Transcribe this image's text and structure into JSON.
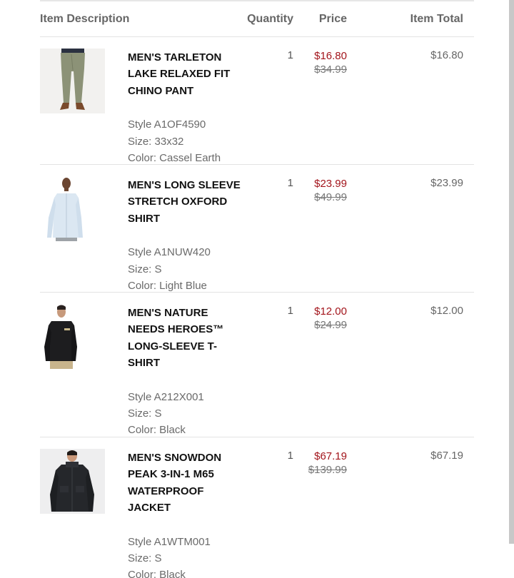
{
  "header": {
    "description": "Item Description",
    "quantity": "Quantity",
    "price": "Price",
    "total": "Item Total"
  },
  "items": [
    {
      "name": "MEN'S TARLETON LAKE RELAXED FIT CHINO PANT",
      "style": "Style A1OF4590",
      "size": "Size: 33x32",
      "color": "Color: Cassel Earth",
      "quantity": "1",
      "sale_price": "$16.80",
      "original_price": "$34.99",
      "total": "$16.80",
      "image": "chino-pant-photo"
    },
    {
      "name": "MEN'S LONG SLEEVE STRETCH OXFORD SHIRT",
      "style": "Style A1NUW420",
      "size": "Size: S",
      "color": "Color: Light Blue",
      "quantity": "1",
      "sale_price": "$23.99",
      "original_price": "$49.99",
      "total": "$23.99",
      "image": "oxford-shirt-photo"
    },
    {
      "name": "MEN'S NATURE NEEDS HEROES™ LONG-SLEEVE T-SHIRT",
      "style": "Style A212X001",
      "size": "Size: S",
      "color": "Color: Black",
      "quantity": "1",
      "sale_price": "$12.00",
      "original_price": "$24.99",
      "total": "$12.00",
      "image": "long-sleeve-tshirt-photo"
    },
    {
      "name": "MEN'S SNOWDON PEAK 3-IN-1 M65 WATERPROOF JACKET",
      "style": "Style A1WTM001",
      "size": "Size: S",
      "color": "Color: Black",
      "quantity": "1",
      "sale_price": "$67.19",
      "original_price": "$139.99",
      "total": "$67.19",
      "image": "waterproof-jacket-photo"
    }
  ],
  "colors": {
    "sale_price": "#a3151c",
    "text": "#111111",
    "muted": "#6a6a6a"
  }
}
